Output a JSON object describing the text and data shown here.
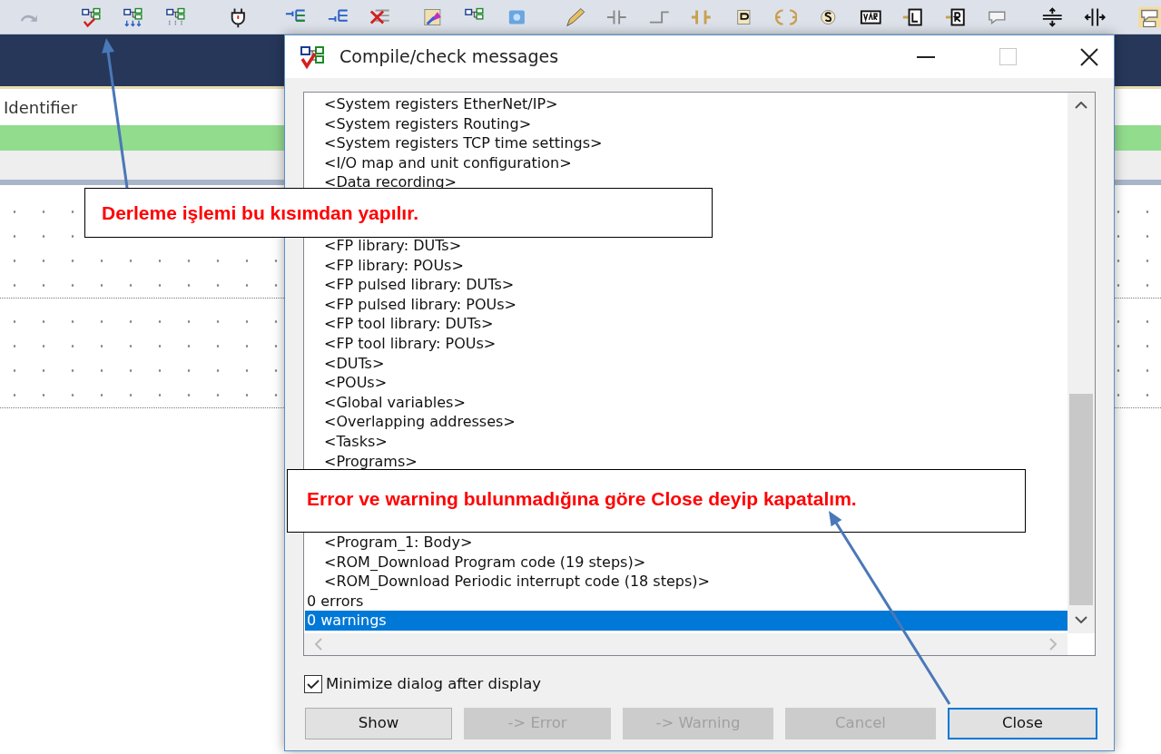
{
  "editor": {
    "header": "Identifier"
  },
  "dialog": {
    "title": "Compile/check messages",
    "message_groups": [
      [
        {
          "text": "<System registers EtherNet/IP>",
          "kind": "entry",
          "selected": false
        },
        {
          "text": "<System registers Routing>",
          "kind": "entry",
          "selected": false
        },
        {
          "text": "<System registers TCP time settings>",
          "kind": "entry",
          "selected": false
        },
        {
          "text": "<I/O map and unit configuration>",
          "kind": "entry",
          "selected": false
        },
        {
          "text": "<Data recording>",
          "kind": "entry",
          "selected": false
        }
      ],
      [
        {
          "text": "<FP library: DUTs>",
          "kind": "entry",
          "selected": false
        },
        {
          "text": "<FP library: POUs>",
          "kind": "entry",
          "selected": false
        },
        {
          "text": "<FP pulsed library: DUTs>",
          "kind": "entry",
          "selected": false
        },
        {
          "text": "<FP pulsed library: POUs>",
          "kind": "entry",
          "selected": false
        },
        {
          "text": "<FP tool library: DUTs>",
          "kind": "entry",
          "selected": false
        },
        {
          "text": "<FP tool library: POUs>",
          "kind": "entry",
          "selected": false
        },
        {
          "text": "<DUTs>",
          "kind": "entry",
          "selected": false
        },
        {
          "text": "<POUs>",
          "kind": "entry",
          "selected": false
        },
        {
          "text": "<Global variables>",
          "kind": "entry",
          "selected": false
        },
        {
          "text": "<Overlapping addresses>",
          "kind": "entry",
          "selected": false
        },
        {
          "text": "<Tasks>",
          "kind": "entry",
          "selected": false
        },
        {
          "text": "<Programs>",
          "kind": "entry",
          "selected": false
        }
      ],
      [
        {
          "text": "<Program_1: Body>",
          "kind": "entry",
          "selected": false
        },
        {
          "text": "<ROM_Download Program code (19 steps)>",
          "kind": "entry",
          "selected": false
        },
        {
          "text": "<ROM_Download Periodic interrupt code (18 steps)>",
          "kind": "entry",
          "selected": false
        },
        {
          "text": "0 errors",
          "kind": "summary",
          "selected": false
        },
        {
          "text": "0 warnings",
          "kind": "summary",
          "selected": true
        }
      ]
    ],
    "minimize_option": {
      "label": "Minimize dialog after display",
      "checked": true
    },
    "buttons": [
      {
        "label": "Show",
        "disabled": false,
        "focused": false
      },
      {
        "label": "-> Error",
        "disabled": true,
        "focused": false
      },
      {
        "label": "-> Warning",
        "disabled": true,
        "focused": false
      },
      {
        "label": "Cancel",
        "disabled": true,
        "focused": false
      },
      {
        "label": "Close",
        "disabled": false,
        "focused": true
      }
    ]
  },
  "annotations": [
    {
      "text": "Derleme işlemi bu kısımdan yapılır."
    },
    {
      "text": "Error ve warning bulunmadığına göre Close deyip kapatalım."
    }
  ]
}
